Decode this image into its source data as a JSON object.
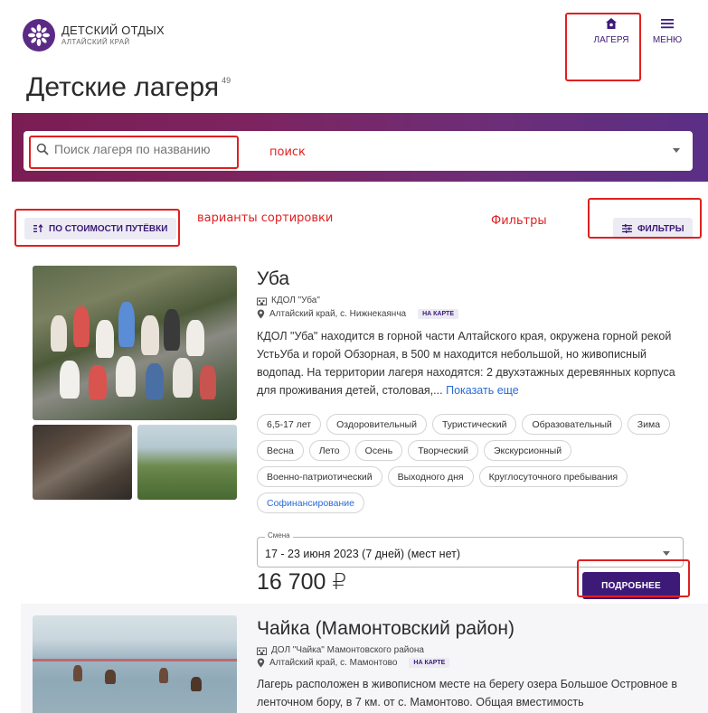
{
  "header": {
    "brand_title": "ДЕТСКИЙ ОТДЫХ",
    "brand_subtitle": "АЛТАЙСКИЙ КРАЙ",
    "nav": [
      {
        "label": "ЛАГЕРЯ",
        "icon": "home-icon"
      },
      {
        "label": "МЕНЮ",
        "icon": "menu-icon"
      }
    ]
  },
  "page": {
    "title": "Детские лагеря",
    "count": "49"
  },
  "search": {
    "placeholder": "Поиск лагеря по названию"
  },
  "toolbar": {
    "sort_label": "ПО СТОИМОСТИ ПУТЁВКИ",
    "filter_label": "ФИЛЬТРЫ"
  },
  "annotations": {
    "search": "поиск",
    "sort": "варианты сортировки",
    "filters": "Фильтры"
  },
  "camps": [
    {
      "name": "Уба",
      "org": "КДОЛ \"Уба\"",
      "location": "Алтайский край, с. Нижнекаянча",
      "map_label": "НА КАРТЕ",
      "description": "КДОЛ \"Уба\" находится в горной части Алтайского края, окружена горной рекой УстьУба и горой Обзорная, в 500 м находится небольшой, но живописный водопад. На территории лагеря находятся: 2 двухэтажных деревянных корпуса для проживания детей, столовая,...",
      "more_label": "Показать еще",
      "tags": [
        "6,5-17 лет",
        "Оздоровительный",
        "Туристический",
        "Образовательный",
        "Зима",
        "Весна",
        "Лето",
        "Осень",
        "Творческий",
        "Экскурсионный",
        "Военно-патриотический",
        "Выходного дня",
        "Круглосуточного пребывания"
      ],
      "tag_highlight": "Софинансирование",
      "shift_label": "Смена",
      "shift_value": "17 - 23 июня 2023 (7 дней) (мест нет)",
      "price": "16 700 ₽",
      "details_label": "ПОДРОБНЕЕ"
    },
    {
      "name": "Чайка (Мамонтовский район)",
      "org": "ДОЛ \"Чайка\" Мамонтовского района",
      "location": "Алтайский край, с. Мамонтово",
      "map_label": "НА КАРТЕ",
      "description": "Лагерь расположен в живописном месте на берегу озера Большое Островное в ленточном бору, в 7 км. от с. Мамонтово. Общая вместимость"
    }
  ],
  "colors": {
    "accent": "#3d1a78",
    "gradient_start": "#7a1d53",
    "gradient_end": "#5a2f86",
    "annotation": "#e02020",
    "link": "#2a6bd6"
  }
}
